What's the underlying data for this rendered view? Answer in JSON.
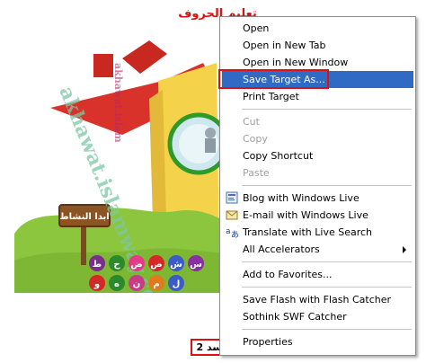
{
  "page": {
    "title": "تعليم الحروف",
    "bottom_text": "2 باسد"
  },
  "flash": {
    "sign_text": "ابدا النشاط",
    "watermark": "akhawat.islamway.com",
    "letters_row1": [
      "ط",
      "ح",
      "ض",
      "ص",
      "ش",
      "س"
    ],
    "letters_row2": [
      "و",
      "ه",
      "ن",
      "م",
      "ل"
    ]
  },
  "menu": {
    "items": [
      {
        "label": "Open"
      },
      {
        "label": "Open in New Tab"
      },
      {
        "label": "Open in New Window"
      },
      {
        "label": "Save Target As..."
      },
      {
        "label": "Print Target"
      },
      {
        "label": "Cut"
      },
      {
        "label": "Copy"
      },
      {
        "label": "Copy Shortcut"
      },
      {
        "label": "Paste"
      },
      {
        "label": "Blog with Windows Live"
      },
      {
        "label": "E-mail with Windows Live"
      },
      {
        "label": "Translate with Live Search"
      },
      {
        "label": "All Accelerators"
      },
      {
        "label": "Add to Favorites..."
      },
      {
        "label": "Save Flash with Flash Catcher"
      },
      {
        "label": "Sothink SWF Catcher"
      },
      {
        "label": "Properties"
      }
    ]
  },
  "colors": {
    "highlight": "#316ac5",
    "annotation_red": "#e01010",
    "disabled": "#a0a0a0"
  }
}
